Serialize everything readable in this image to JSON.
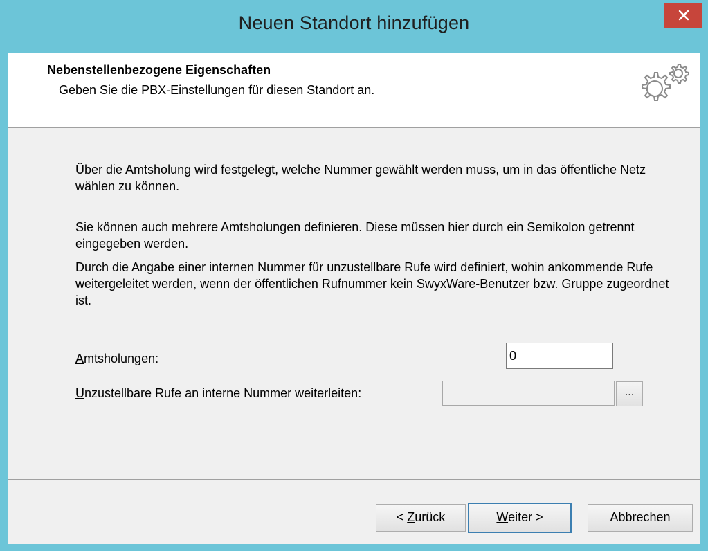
{
  "window": {
    "title": "Neuen Standort hinzufügen"
  },
  "header": {
    "title": "Nebenstellenbezogene Eigenschaften",
    "subtitle": "Geben Sie die PBX-Einstellungen für diesen Standort an.",
    "icon": "gears-icon"
  },
  "body": {
    "paragraph1": "Über die Amtsholung wird festgelegt, welche Nummer gewählt werden muss, um in das öffentliche Netz wählen zu können.",
    "paragraph2": "Sie können auch mehrere Amtsholungen definieren. Diese müssen hier durch ein Semikolon getrennt eingegeben werden.",
    "paragraph3": "Durch die Angabe einer internen Nummer für unzustellbare Rufe wird definiert, wohin ankommende Rufe weitergeleitet werden, wenn der öffentlichen Rufnummer kein SwyxWare-Benutzer bzw. Gruppe zugeordnet ist."
  },
  "fields": {
    "amtsholungen": {
      "label_hotkey": "A",
      "label_rest": "mtsholungen:",
      "value": "0"
    },
    "unzustellbar": {
      "label_hotkey": "U",
      "label_rest": "nzustellbare Rufe an interne Nummer weiterleiten:",
      "value": "",
      "browse_label": "..."
    }
  },
  "buttons": {
    "back_prefix": "< ",
    "back_hotkey": "Z",
    "back_rest": "urück",
    "next_hotkey": "W",
    "next_rest": "eiter >",
    "cancel": "Abbrechen"
  },
  "colors": {
    "titlebar": "#6cc5d8",
    "close": "#c7453b",
    "client_bg": "#f0f0f0"
  }
}
